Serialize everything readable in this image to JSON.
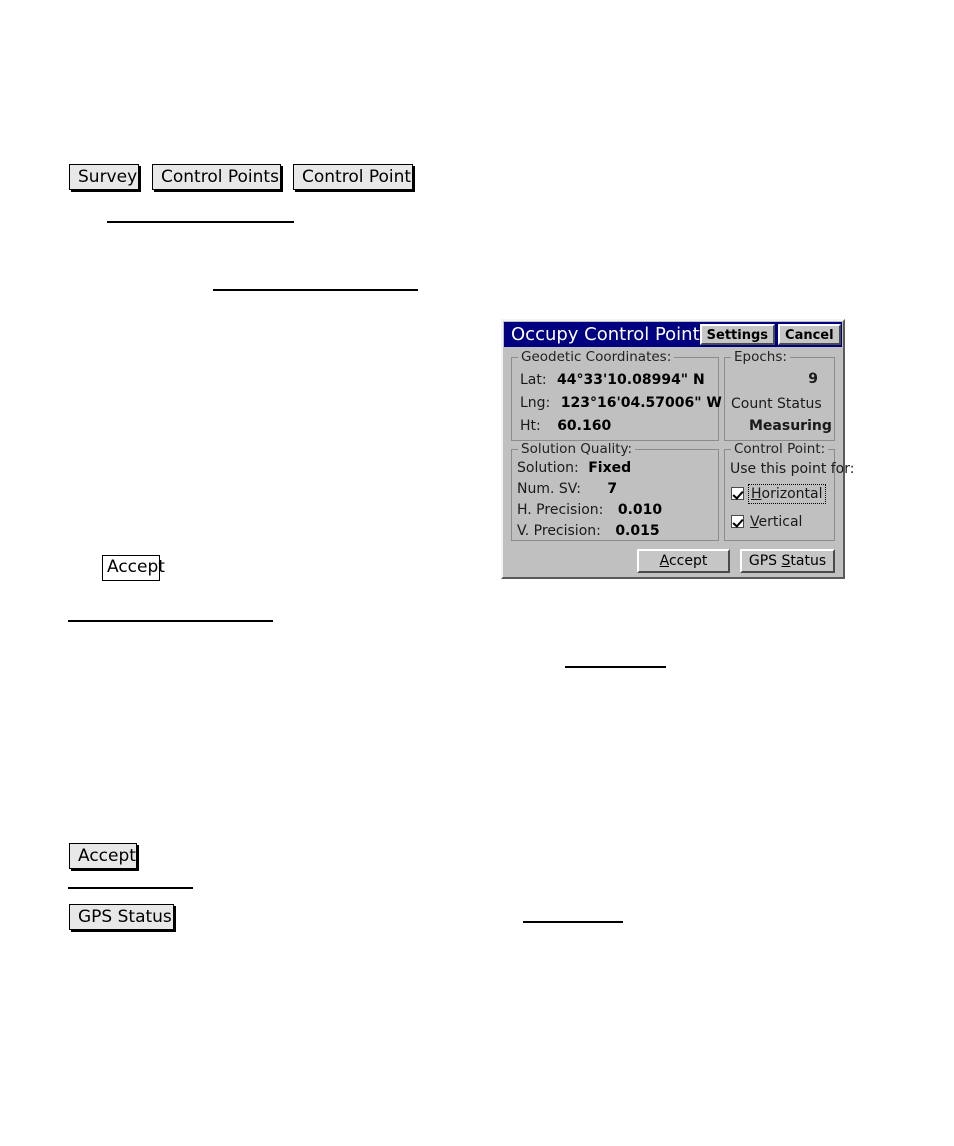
{
  "document": {
    "nav_buttons": [
      {
        "label": "Survey"
      },
      {
        "label": "Control Points"
      },
      {
        "label": "Control Point"
      }
    ],
    "inline_buttons": [
      {
        "label": "Accept"
      },
      {
        "label": "Accept"
      },
      {
        "label": "GPS Status"
      }
    ]
  },
  "dialog": {
    "title": "Occupy Control Point",
    "titlebar_buttons": [
      {
        "label": "Settings"
      },
      {
        "label": "Cancel"
      }
    ],
    "geodetic": {
      "legend": "Geodetic Coordinates:",
      "lat_label": "Lat:",
      "lat_value": "44°33'10.08994\" N",
      "lng_label": "Lng:",
      "lng_value": "123°16'04.57006\" W",
      "ht_label": "Ht:",
      "ht_value": "60.160"
    },
    "epochs": {
      "legend": "Epochs:",
      "count": "9",
      "count_status_label": "Count Status",
      "count_status_value": "Measuring"
    },
    "solution_quality": {
      "legend": "Solution Quality:",
      "solution_label": "Solution:",
      "solution_value": "Fixed",
      "num_sv_label": "Num. SV:",
      "num_sv_value": "7",
      "h_precision_label": "H. Precision:",
      "h_precision_value": "0.010",
      "v_precision_label": "V. Precision:",
      "v_precision_value": "0.015"
    },
    "control_point": {
      "legend": "Control Point:",
      "instruction": "Use this point for:",
      "horizontal_label": "Horizontal",
      "horizontal_accel": "H",
      "horizontal_rest": "orizontal",
      "horizontal_checked": true,
      "vertical_label": "Vertical",
      "vertical_accel": "V",
      "vertical_rest": "ertical",
      "vertical_checked": true
    },
    "actions": {
      "accept_accel": "A",
      "accept_rest": "ccept",
      "gps_status_pre": "GPS ",
      "gps_status_accel": "S",
      "gps_status_rest": "tatus"
    },
    "colors": {
      "titlebar": "#000080",
      "dialog_face": "#c0c0c0",
      "button_face": "#c6c6c6",
      "title_text": "#ffffff"
    }
  }
}
